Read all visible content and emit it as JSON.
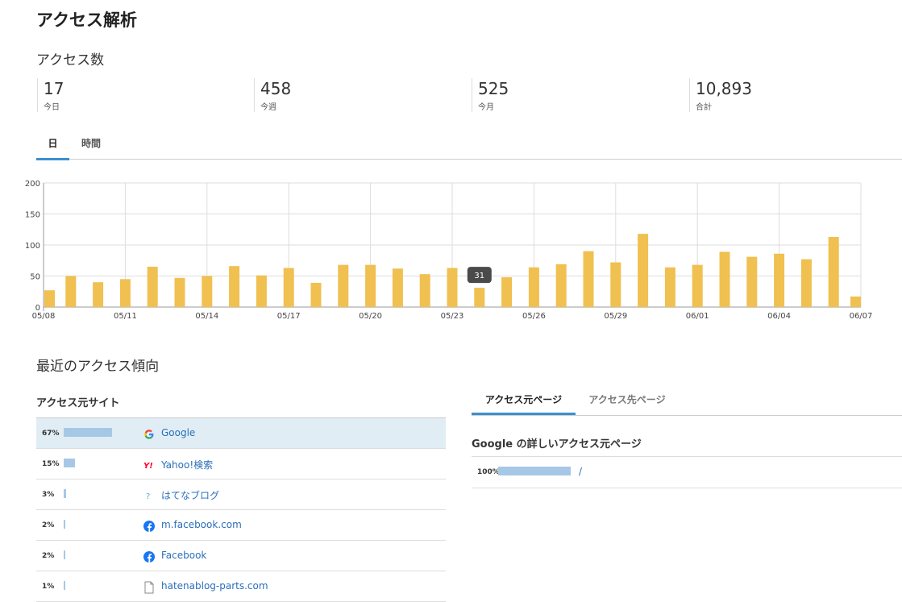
{
  "page_title": "アクセス解析",
  "access_count": {
    "title": "アクセス数",
    "stats": [
      {
        "value": "17",
        "label": "今日"
      },
      {
        "value": "458",
        "label": "今週"
      },
      {
        "value": "525",
        "label": "今月"
      },
      {
        "value": "10,893",
        "label": "合計"
      }
    ]
  },
  "period_tabs": [
    {
      "label": "日",
      "active": true
    },
    {
      "label": "時間",
      "active": false
    }
  ],
  "chart_data": {
    "type": "bar",
    "categories": [
      "05/08",
      "05/09",
      "05/10",
      "05/11",
      "05/12",
      "05/13",
      "05/14",
      "05/15",
      "05/16",
      "05/17",
      "05/18",
      "05/19",
      "05/20",
      "05/21",
      "05/22",
      "05/23",
      "05/24",
      "05/25",
      "05/26",
      "05/27",
      "05/28",
      "05/29",
      "05/30",
      "05/31",
      "06/01",
      "06/02",
      "06/03",
      "06/04",
      "06/05",
      "06/06",
      "06/07"
    ],
    "x_tick_labels": [
      "05/08",
      "05/11",
      "05/14",
      "05/17",
      "05/20",
      "05/23",
      "05/26",
      "05/29",
      "06/01",
      "06/04",
      "06/07"
    ],
    "values": [
      27,
      50,
      40,
      45,
      65,
      47,
      50,
      66,
      51,
      63,
      39,
      68,
      68,
      62,
      53,
      63,
      31,
      48,
      64,
      69,
      90,
      72,
      118,
      64,
      68,
      89,
      81,
      86,
      77,
      113,
      17
    ],
    "ylim": [
      0,
      200
    ],
    "y_ticks": [
      0,
      50,
      100,
      150,
      200
    ],
    "bar_color": "#f0c050",
    "grid": true,
    "tooltip": {
      "category": "05/24",
      "text": "31"
    }
  },
  "trend": {
    "title": "最近のアクセス傾向",
    "sources_title": "アクセス元サイト",
    "sources": [
      {
        "pct": "67%",
        "share": 0.67,
        "icon": "google-icon",
        "name": "Google",
        "selected": true
      },
      {
        "pct": "15%",
        "share": 0.15,
        "icon": "yahoo-icon",
        "name": "Yahoo!検索",
        "selected": false
      },
      {
        "pct": "3%",
        "share": 0.03,
        "icon": "hatena-icon",
        "name": "はてなブログ",
        "selected": false
      },
      {
        "pct": "2%",
        "share": 0.02,
        "icon": "facebook-icon",
        "name": "m.facebook.com",
        "selected": false
      },
      {
        "pct": "2%",
        "share": 0.02,
        "icon": "facebook-icon",
        "name": "Facebook",
        "selected": false
      },
      {
        "pct": "1%",
        "share": 0.01,
        "icon": "page-icon",
        "name": "hatenablog-parts.com",
        "selected": false
      }
    ],
    "right_tabs": [
      {
        "label": "アクセス元ページ",
        "active": true
      },
      {
        "label": "アクセス先ページ",
        "active": false
      }
    ],
    "detail_title": "Google の詳しいアクセス元ページ",
    "detail_rows": [
      {
        "pct": "100%",
        "share": 1.0,
        "name": "/"
      }
    ]
  },
  "colors": {
    "accent": "#3a8fd0",
    "bar": "#f0c050",
    "share_bar": "#a6c8e6",
    "link": "#2a6ebb"
  }
}
